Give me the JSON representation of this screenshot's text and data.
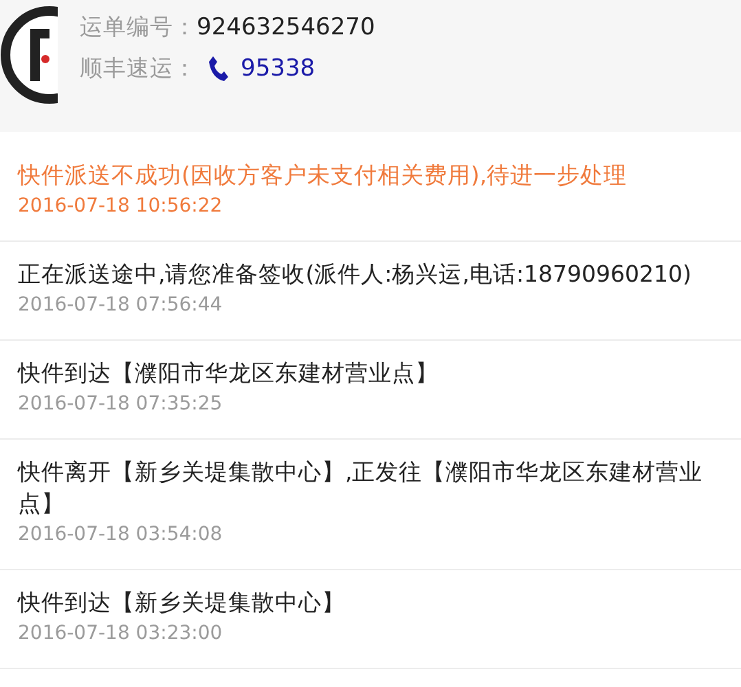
{
  "header": {
    "waybill_label": "运单编号：",
    "waybill_number": "924632546270",
    "carrier_label": "顺丰速运：",
    "phone": "95338"
  },
  "events": [
    {
      "text": "快件派送不成功(因收方客户未支付相关费用),待进一步处理",
      "time": "2016-07-18 10:56:22",
      "current": true
    },
    {
      "text": "正在派送途中,请您准备签收(派件人:杨兴运,电话:18790960210)",
      "time": "2016-07-18 07:56:44",
      "current": false
    },
    {
      "text": "快件到达【濮阳市华龙区东建材营业点】",
      "time": "2016-07-18 07:35:25",
      "current": false
    },
    {
      "text": "快件离开【新乡关堤集散中心】,正发往【濮阳市华龙区东建材营业点】",
      "time": "2016-07-18 03:54:08",
      "current": false
    },
    {
      "text": "快件到达【新乡关堤集散中心】",
      "time": "2016-07-18 03:23:00",
      "current": false
    }
  ]
}
